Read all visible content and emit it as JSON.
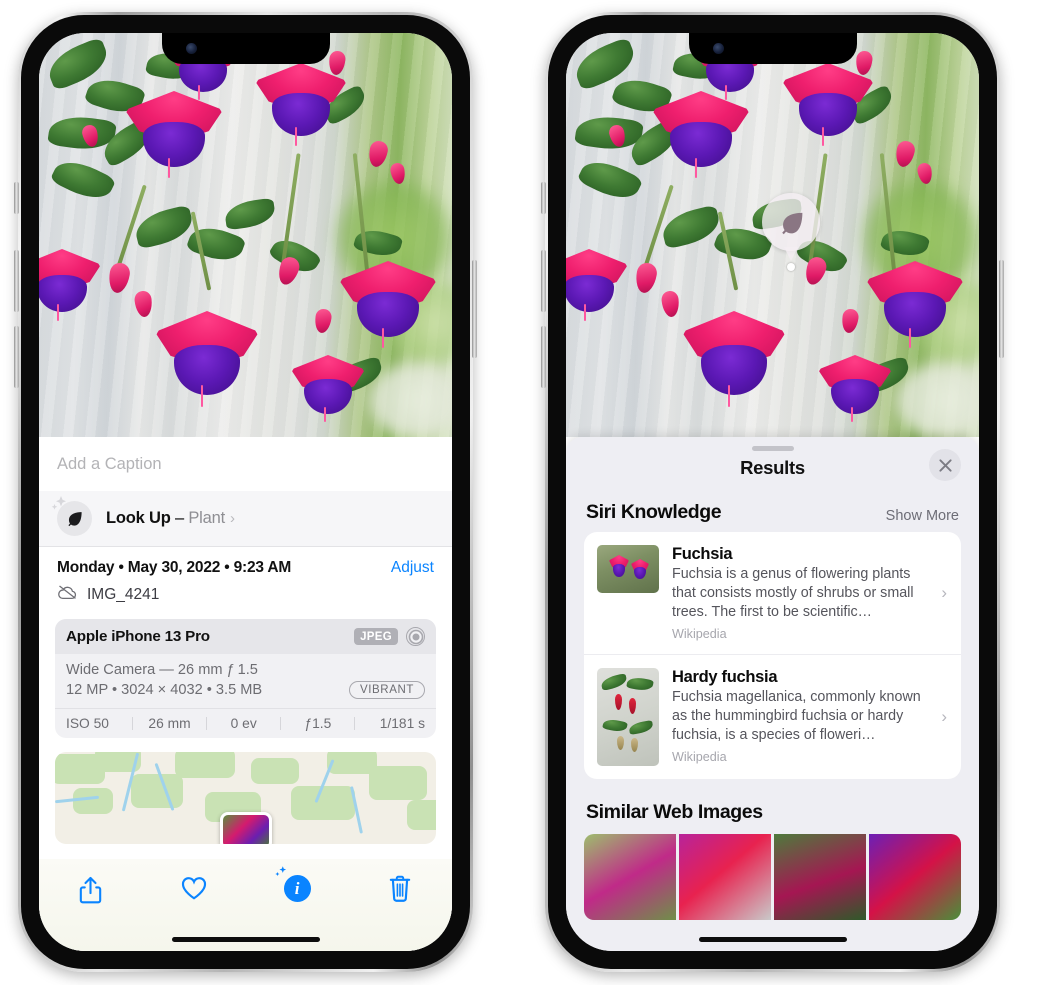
{
  "left_phone": {
    "name": "iphone-photos-info",
    "caption_placeholder": "Add a Caption",
    "lookup": {
      "title": "Look Up",
      "dash": " – ",
      "subject": "Plant",
      "chevron": "›",
      "icon": "leaf-icon"
    },
    "meta": {
      "date": "Monday • May 30, 2022 • 9:23 AM",
      "adjust_label": "Adjust",
      "filename": "IMG_4241",
      "cloud_icon": "cloud-slash-icon"
    },
    "camera": {
      "device": "Apple iPhone 13 Pro",
      "format_badge": "JPEG",
      "hdr_icon": "hdr-circles-icon",
      "lens": "Wide Camera — 26 mm ƒ 1.5",
      "specs": "12 MP • 3024 × 4032 • 3.5 MB",
      "style_badge": "VIBRANT",
      "exif": [
        "ISO 50",
        "26 mm",
        "0 ev",
        "ƒ1.5",
        "1/181 s"
      ]
    },
    "toolbar": [
      {
        "label": "Share",
        "icon": "share-icon"
      },
      {
        "label": "Favorite",
        "icon": "heart-icon"
      },
      {
        "label": "Info",
        "icon": "info-sparkle-icon"
      },
      {
        "label": "Delete",
        "icon": "trash-icon"
      }
    ]
  },
  "right_phone": {
    "name": "iphone-visual-lookup-results",
    "pin": {
      "icon": "leaf-icon",
      "label": "Visual Look Up pin"
    },
    "panel": {
      "title": "Results",
      "close_icon": "close-icon",
      "grabber": "drag-handle"
    },
    "siri_knowledge": {
      "heading": "Siri Knowledge",
      "show_more": "Show More",
      "items": [
        {
          "name": "Fuchsia",
          "description": "Fuchsia is a genus of flowering plants that consists mostly of shrubs or small trees. The first to be scientific…",
          "source": "Wikipedia",
          "chevron": "›"
        },
        {
          "name": "Hardy fuchsia",
          "description": "Fuchsia magellanica, commonly known as the hummingbird fuchsia or hardy fuchsia, is a species of floweri…",
          "source": "Wikipedia",
          "chevron": "›"
        }
      ]
    },
    "similar_web_images": {
      "heading": "Similar Web Images",
      "thumbs": [
        "fuchsia-thumb-1",
        "fuchsia-thumb-2",
        "fuchsia-thumb-3",
        "fuchsia-thumb-4"
      ]
    }
  },
  "colors": {
    "accent_blue": "#0a84ff",
    "panel_bg": "#eeeef3",
    "card_bg": "#ffffff",
    "secondary_text": "#8e8e93"
  }
}
